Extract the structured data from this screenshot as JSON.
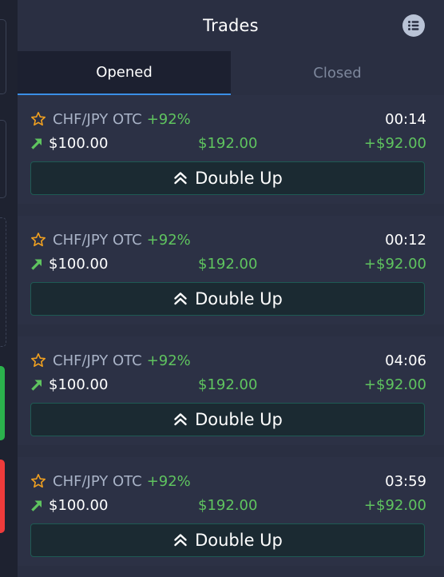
{
  "header": {
    "title": "Trades"
  },
  "tabs": [
    {
      "label": "Opened",
      "active": true
    },
    {
      "label": "Closed",
      "active": false
    }
  ],
  "trades": [
    {
      "asset": "CHF/JPY OTC",
      "payout_pct": "+92%",
      "timer": "00:14",
      "amount": "$100.00",
      "payout": "$192.00",
      "profit": "+$92.00",
      "direction": "up",
      "action_label": "Double Up"
    },
    {
      "asset": "CHF/JPY OTC",
      "payout_pct": "+92%",
      "timer": "00:12",
      "amount": "$100.00",
      "payout": "$192.00",
      "profit": "+$92.00",
      "direction": "up",
      "action_label": "Double Up"
    },
    {
      "asset": "CHF/JPY OTC",
      "payout_pct": "+92%",
      "timer": "04:06",
      "amount": "$100.00",
      "payout": "$192.00",
      "profit": "+$92.00",
      "direction": "up",
      "action_label": "Double Up"
    },
    {
      "asset": "CHF/JPY OTC",
      "payout_pct": "+92%",
      "timer": "03:59",
      "amount": "$100.00",
      "payout": "$192.00",
      "profit": "+$92.00",
      "direction": "up",
      "action_label": "Double Up"
    }
  ],
  "colors": {
    "profit_green": "#5fc45f",
    "star_orange": "#f0a020",
    "call_green": "#2bb24c",
    "put_red": "#ef3b3b",
    "active_tab_underline": "#3a8ee6"
  }
}
